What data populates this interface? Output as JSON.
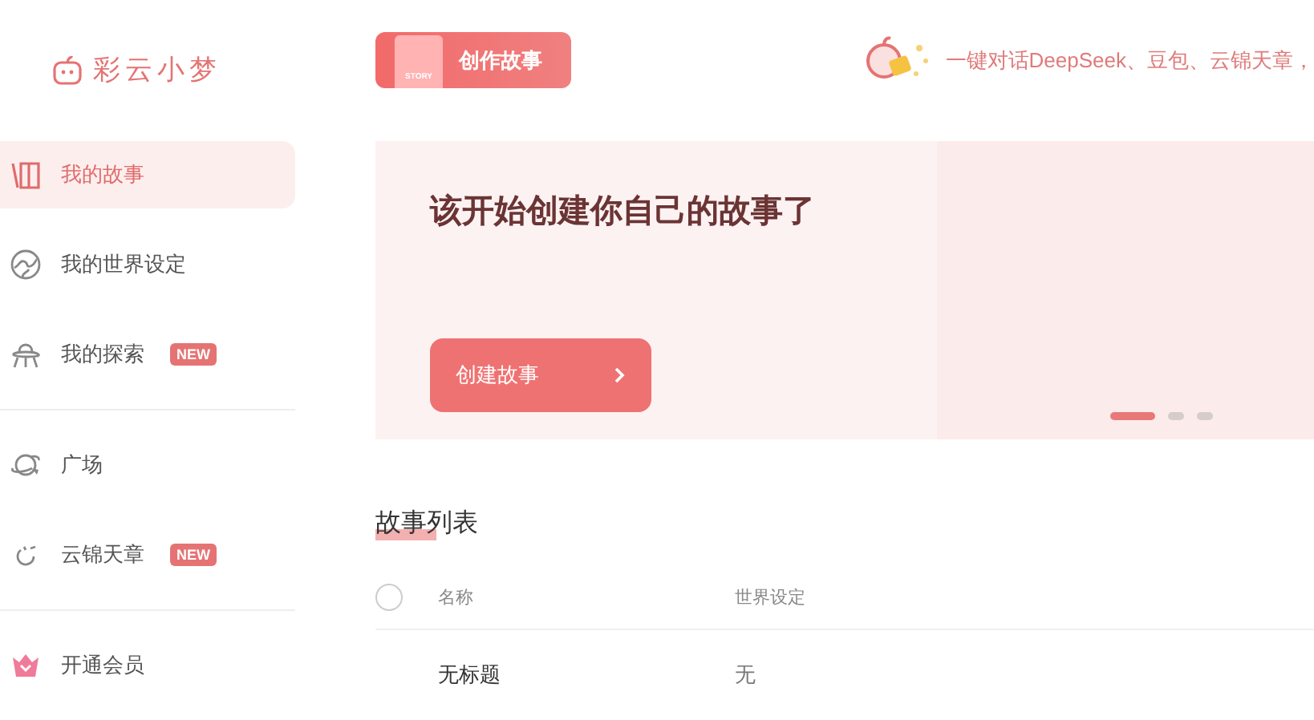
{
  "logo": {
    "text": "彩云小梦"
  },
  "sidebar": {
    "groups": [
      {
        "items": [
          {
            "label": "我的故事",
            "selected": true
          },
          {
            "label": "我的世界设定",
            "selected": false
          },
          {
            "label": "我的探索",
            "selected": false,
            "badge": "NEW"
          }
        ]
      },
      {
        "items": [
          {
            "label": "广场",
            "selected": false
          },
          {
            "label": "云锦天章",
            "selected": false,
            "badge": "NEW"
          }
        ]
      },
      {
        "items": [
          {
            "label": "开通会员",
            "selected": false
          }
        ]
      }
    ]
  },
  "create_button": {
    "label": "创作故事",
    "tag": "STORY"
  },
  "promo": {
    "text": "一键对话DeepSeek、豆包、云锦天章，"
  },
  "banner": {
    "title": "该开始创建你自己的故事了",
    "button": "创建故事",
    "dots": [
      {
        "selected": true
      },
      {
        "selected": false
      },
      {
        "selected": false
      }
    ]
  },
  "story_list": {
    "title": "故事列表",
    "columns": [
      "名称",
      "世界设定"
    ],
    "rows": [
      {
        "cells": [
          "无标题",
          "无"
        ]
      }
    ],
    "all_checked": false
  }
}
